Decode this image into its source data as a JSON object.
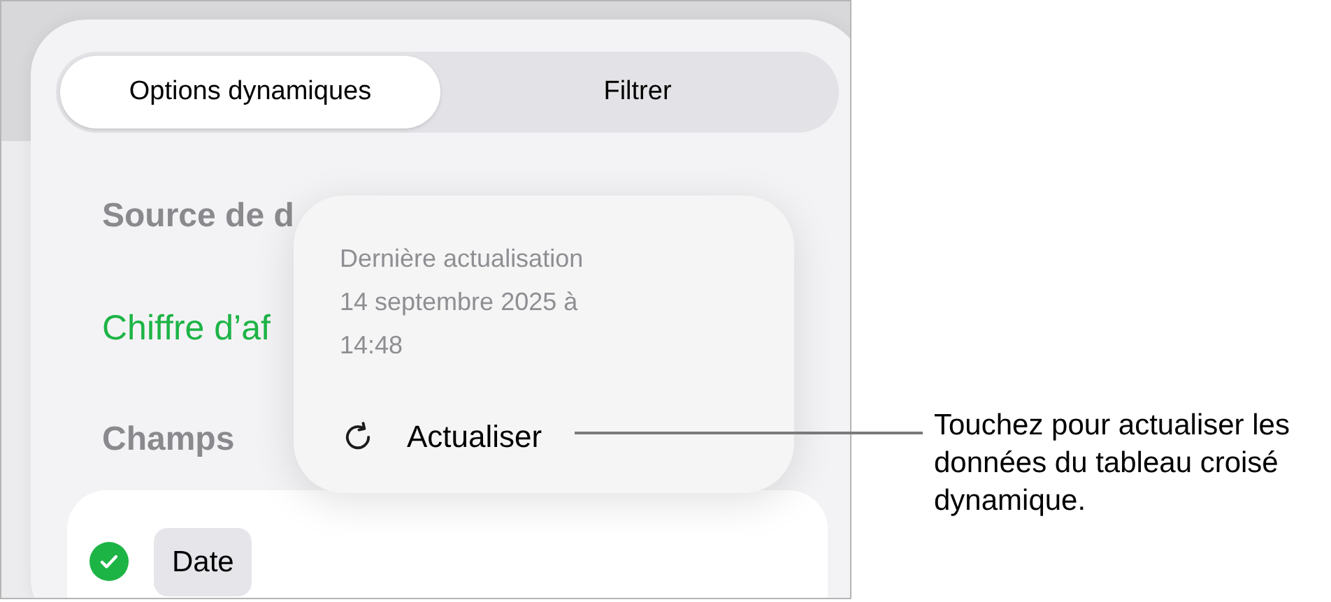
{
  "tabs": [
    {
      "label": "Options dynamiques",
      "selected": true
    },
    {
      "label": "Filtrer",
      "selected": false
    }
  ],
  "source_heading": "Source de d",
  "source_value": "Chiffre d’af",
  "fields_heading": "Champs",
  "fields": [
    {
      "label": "Date",
      "checked": true
    }
  ],
  "popover": {
    "lines": [
      "Dernière actualisation",
      "14 septembre 2025 à",
      "14:48"
    ],
    "button": "Actualiser"
  },
  "callout": "Touchez pour actualiser les données du tableau croisé dynamique."
}
